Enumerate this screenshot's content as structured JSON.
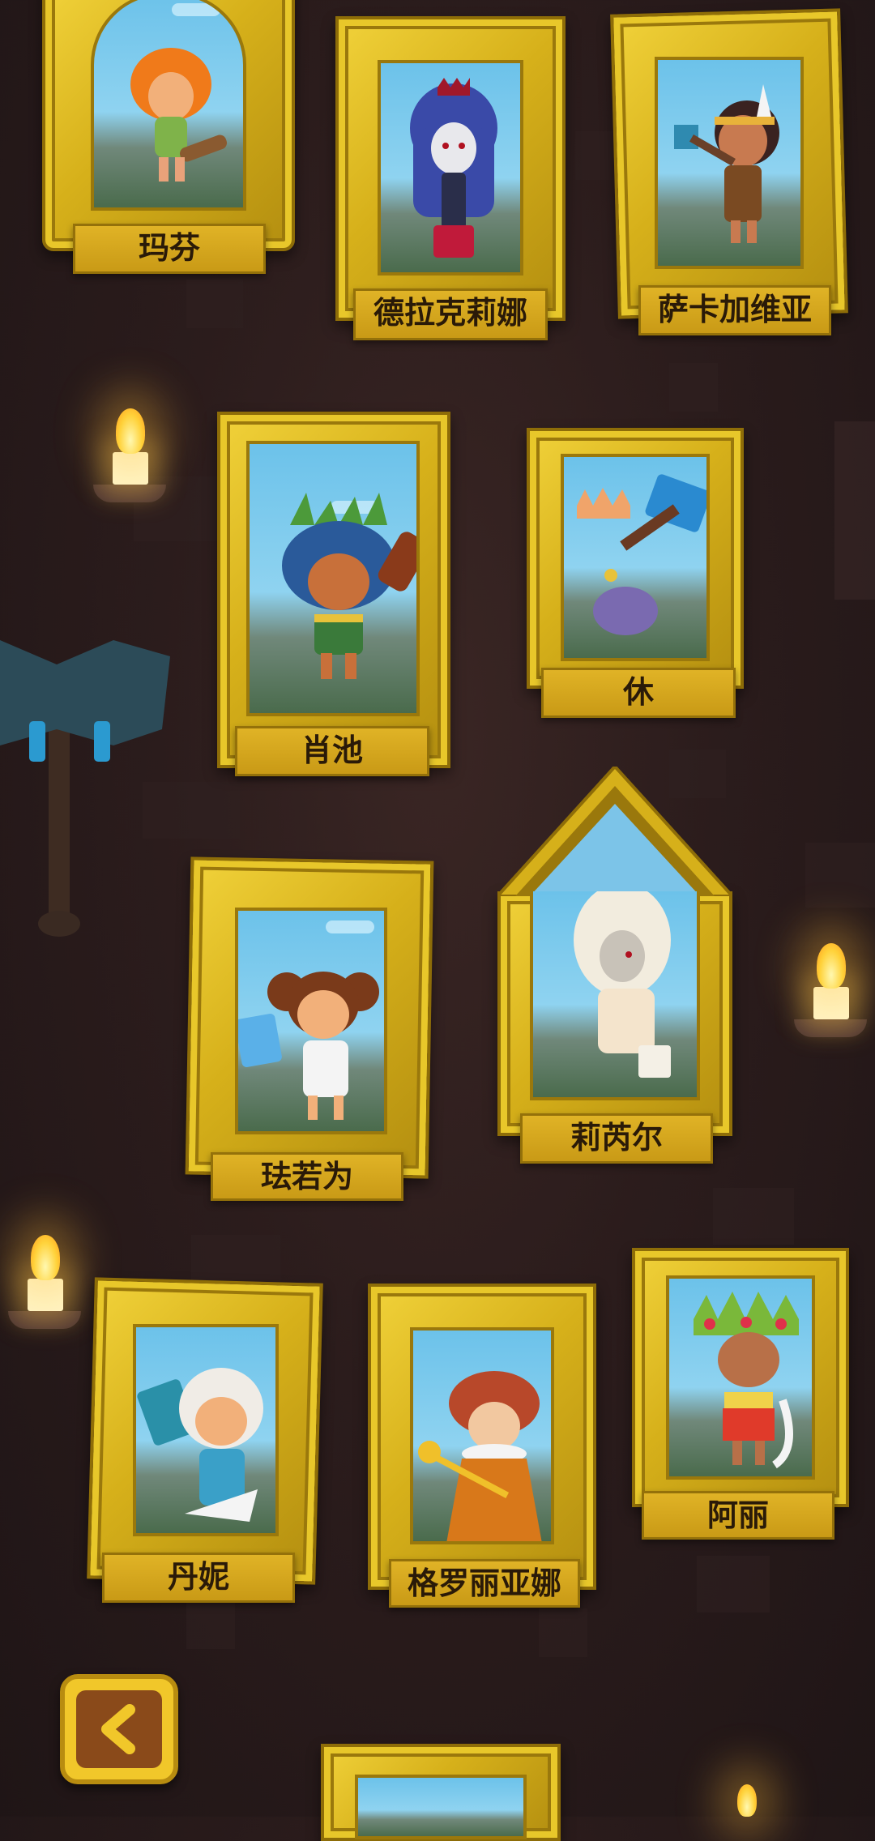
{
  "heroes": [
    {
      "name": "玛芬"
    },
    {
      "name": "德拉克莉娜"
    },
    {
      "name": "萨卡加维亚"
    },
    {
      "name": "肖池"
    },
    {
      "name": "休"
    },
    {
      "name": "珐若为"
    },
    {
      "name": "莉芮尔"
    },
    {
      "name": "丹妮"
    },
    {
      "name": "格罗丽亚娜"
    },
    {
      "name": "阿丽"
    }
  ],
  "icons": {
    "back": "chevron-left-icon",
    "torch": "torch-icon",
    "axe": "axe-icon"
  },
  "colors": {
    "gold": "#e0b326",
    "background": "#2b1c1c",
    "sky": "#6cc2ea"
  }
}
